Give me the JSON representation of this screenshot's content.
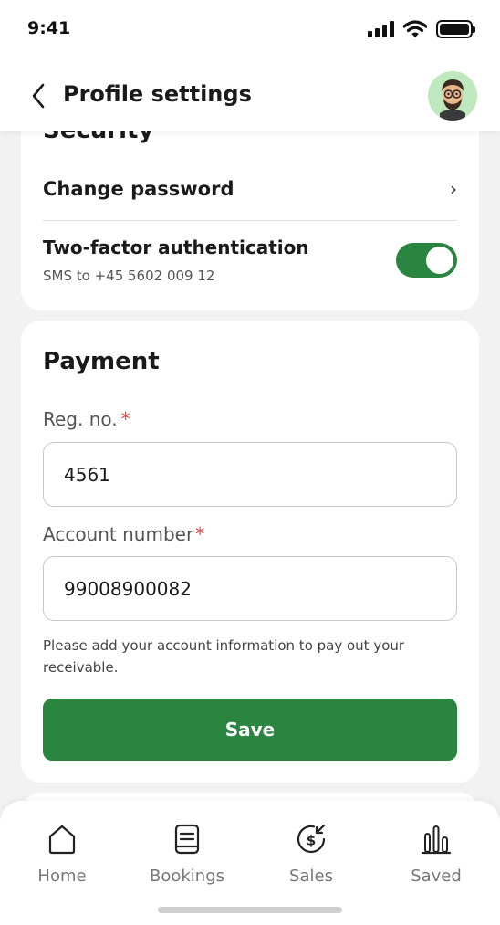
{
  "status_bar": {
    "time": "9:41"
  },
  "header": {
    "title": "Profile settings",
    "back_icon": "chevron-left-icon",
    "avatar": "user-avatar"
  },
  "security": {
    "heading": "Security",
    "change_password_label": "Change password",
    "chevron": "›",
    "two_factor_title": "Two-factor authentication",
    "two_factor_subtitle": "SMS to +45 5602 009 12",
    "two_factor_enabled": true
  },
  "payment": {
    "heading": "Payment",
    "reg_no_label": "Reg. no.",
    "reg_no_value": "4561",
    "account_number_label": "Account number",
    "account_number_value": "99008900082",
    "required_mark": "*",
    "help_text": "Please add your account information to pay out your receivable.",
    "save_label": "Save"
  },
  "tabs": [
    {
      "label": "Home",
      "icon": "home-icon"
    },
    {
      "label": "Bookings",
      "icon": "book-icon"
    },
    {
      "label": "Sales",
      "icon": "dollar-refresh-icon"
    },
    {
      "label": "Saved",
      "icon": "bar-chart-icon"
    }
  ],
  "colors": {
    "accent": "#2a8540",
    "required": "#e53935",
    "background": "#f2f2f2"
  }
}
